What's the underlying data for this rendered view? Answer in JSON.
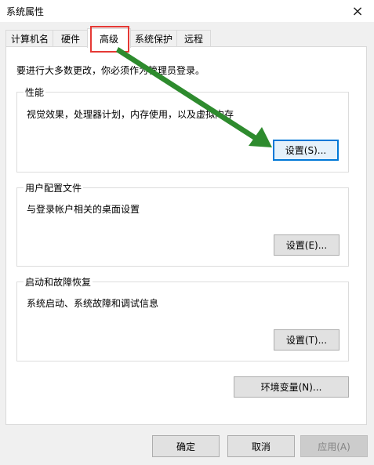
{
  "window": {
    "title": "系统属性",
    "close_icon": "×"
  },
  "tabs": [
    {
      "label": "计算机名"
    },
    {
      "label": "硬件"
    },
    {
      "label": "高级"
    },
    {
      "label": "系统保护"
    },
    {
      "label": "远程"
    }
  ],
  "notice": "要进行大多数更改，你必须作为管理员登录。",
  "performance": {
    "title": "性能",
    "description": "视觉效果，处理器计划，内存使用，以及虚拟内存",
    "button": "设置(S)..."
  },
  "user_profiles": {
    "title": "用户配置文件",
    "description": "与登录帐户相关的桌面设置",
    "button": "设置(E)..."
  },
  "startup_recovery": {
    "title": "启动和故障恢复",
    "description": "系统启动、系统故障和调试信息",
    "button": "设置(T)..."
  },
  "env_button": "环境变量(N)...",
  "footer": {
    "ok": "确定",
    "cancel": "取消",
    "apply": "应用(A)"
  },
  "annotation": {
    "highlight_color": "#e53935",
    "arrow_color": "#2e8b2e"
  }
}
